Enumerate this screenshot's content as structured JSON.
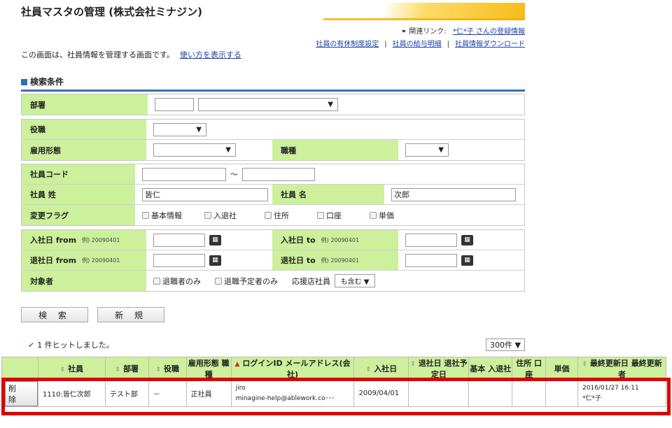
{
  "header": {
    "title": "社員マスタの管理 (株式会社ミナジン)",
    "related_label": "関連リンク:",
    "related_link": "*仁*子 さんの登録情報",
    "links": [
      "社員の有休制度設定",
      "社員の給与明細",
      "社員情報ダウンロード"
    ]
  },
  "description": {
    "text": "この画面は、社員情報を管理する画面です。",
    "help_link": "使い方を表示する"
  },
  "search": {
    "heading": "検索条件",
    "dept_label": "部署",
    "position_label": "役職",
    "employment_label": "雇用形態",
    "jobtype_label": "職種",
    "code_label": "社員コード",
    "code_sep": "〜",
    "lastname_label": "社員 姓",
    "lastname_value": "皆仁",
    "firstname_label": "社員 名",
    "firstname_value": "次郎",
    "flag_label": "変更フラグ",
    "flags": [
      "基本情報",
      "入退社",
      "住所",
      "口座",
      "単価"
    ],
    "join_from_label": "入社日 from",
    "join_to_label": "入社日 to",
    "leave_from_label": "退社日 from",
    "leave_to_label": "退社日 to",
    "example": "例) 20090401",
    "target_label": "対象者",
    "targets": [
      "退職者のみ",
      "退職予定者のみ"
    ],
    "support_label": "応援店社員",
    "support_value": "も含む ▼"
  },
  "buttons": {
    "search": "検 索",
    "new": "新 規"
  },
  "results": {
    "hits": "1 件ヒットしました。",
    "per_page": "300件 ▼",
    "columns": [
      "社員",
      "部署",
      "役職",
      "雇用形態 職種",
      "ログインID メールアドレス(会社)",
      "入社日",
      "退社日 退社予定日",
      "基本 入退社",
      "住所 口座",
      "単価",
      "最終更新日 最終更新者"
    ],
    "rows": [
      {
        "delete": "削 除",
        "employee": "1110:皆仁次郎",
        "dept": "テスト部",
        "position": "－",
        "employment": "正社員",
        "login": "jiro",
        "email": "minagine-help@ablework.co･･･",
        "join_date": "2009/04/01",
        "updated": "2016/01/27 16:11",
        "updater": "*仁*子"
      }
    ]
  }
}
